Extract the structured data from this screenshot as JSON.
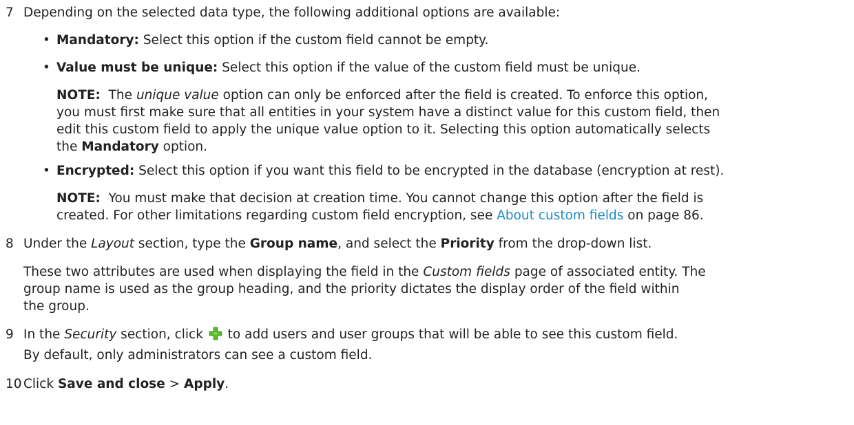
{
  "step7": {
    "number": "7",
    "intro": "Depending on the selected data type, the following additional options are available:",
    "bullets": [
      {
        "term": "Mandatory:",
        "text": " Select this option if the custom field cannot be empty."
      },
      {
        "term": "Value must be unique:",
        "text": " Select this option if the value of the custom field must be unique."
      },
      {
        "term": "Encrypted:",
        "text": " Select this option if you want this field to be encrypted in the database (encryption at rest)."
      }
    ],
    "note1": {
      "label": "NOTE:",
      "pre": "  The ",
      "em": "unique value",
      "line1_rest": " option can only be enforced after the field is created. To enforce this option,",
      "line2": "you must first make sure that all entities in your system have a distinct value for this custom field, then",
      "line3": "edit this custom field to apply the unique value option to it. Selecting this option automatically selects",
      "line4_pre": "the ",
      "line4_bold": "Mandatory",
      "line4_post": " option."
    },
    "note2": {
      "label": "NOTE:",
      "line1_rest": "  You must make that decision at creation time. You cannot change this option after the field is",
      "line2_pre": "created. For other limitations regarding custom field encryption, see ",
      "link": "About custom fields",
      "line2_post": " on page 86."
    }
  },
  "step8": {
    "number": "8",
    "p1": [
      "Under the ",
      "Layout",
      " section, type the ",
      "Group name",
      ", and select the ",
      "Priority",
      " from the drop-down list."
    ],
    "p2_line1_pre": "These two attributes are used when displaying the field in the ",
    "p2_line1_em": "Custom fields",
    "p2_line1_post": " page of associated entity. The",
    "p2_line2": "group name is used as the group heading, and the priority dictates the display order of the field within",
    "p2_line3": "the group."
  },
  "step9": {
    "number": "9",
    "pre": "In the ",
    "em": "Security",
    "mid": " section, click ",
    "post": " to add users and user groups that will be able to see this custom field.",
    "icon": "add-icon",
    "icon_color": "#5cb82e",
    "p2": "By default, only administrators can see a custom field."
  },
  "step10": {
    "number": "10",
    "pre": "Click ",
    "b1": "Save and close",
    "mid": " > ",
    "b2": "Apply",
    "post": "."
  },
  "colors": {
    "text": "#222222",
    "link": "#1a8bc8"
  }
}
